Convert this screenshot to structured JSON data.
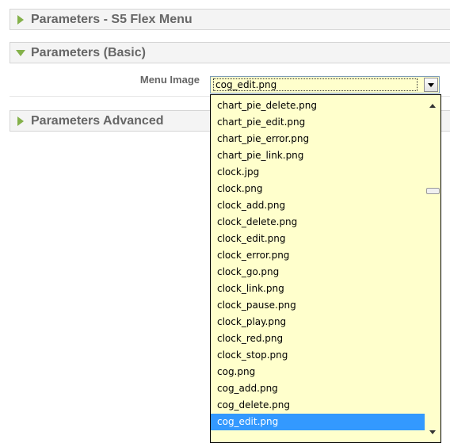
{
  "panels": [
    {
      "title": "Parameters - S5 Flex Menu",
      "expanded": false
    },
    {
      "title": "Parameters (Basic)",
      "expanded": true
    },
    {
      "title": "Parameters Advanced",
      "expanded": false
    }
  ],
  "param": {
    "label": "Menu Image",
    "selected_value": "cog_edit.png"
  },
  "dropdown": {
    "options": [
      "chart_pie_delete.png",
      "chart_pie_edit.png",
      "chart_pie_error.png",
      "chart_pie_link.png",
      "clock.jpg",
      "clock.png",
      "clock_add.png",
      "clock_delete.png",
      "clock_edit.png",
      "clock_error.png",
      "clock_go.png",
      "clock_link.png",
      "clock_pause.png",
      "clock_play.png",
      "clock_red.png",
      "clock_stop.png",
      "cog.png",
      "cog_add.png",
      "cog_delete.png",
      "cog_edit.png"
    ],
    "selected_index": 19
  },
  "colors": {
    "accent_arrow": "#84b14a",
    "select_background": "#ffffcc",
    "selection_highlight": "#3399ff"
  },
  "icons": {
    "collapsed": "triangle-right-icon",
    "expanded": "triangle-down-icon",
    "dropdown": "chevron-down-icon"
  }
}
